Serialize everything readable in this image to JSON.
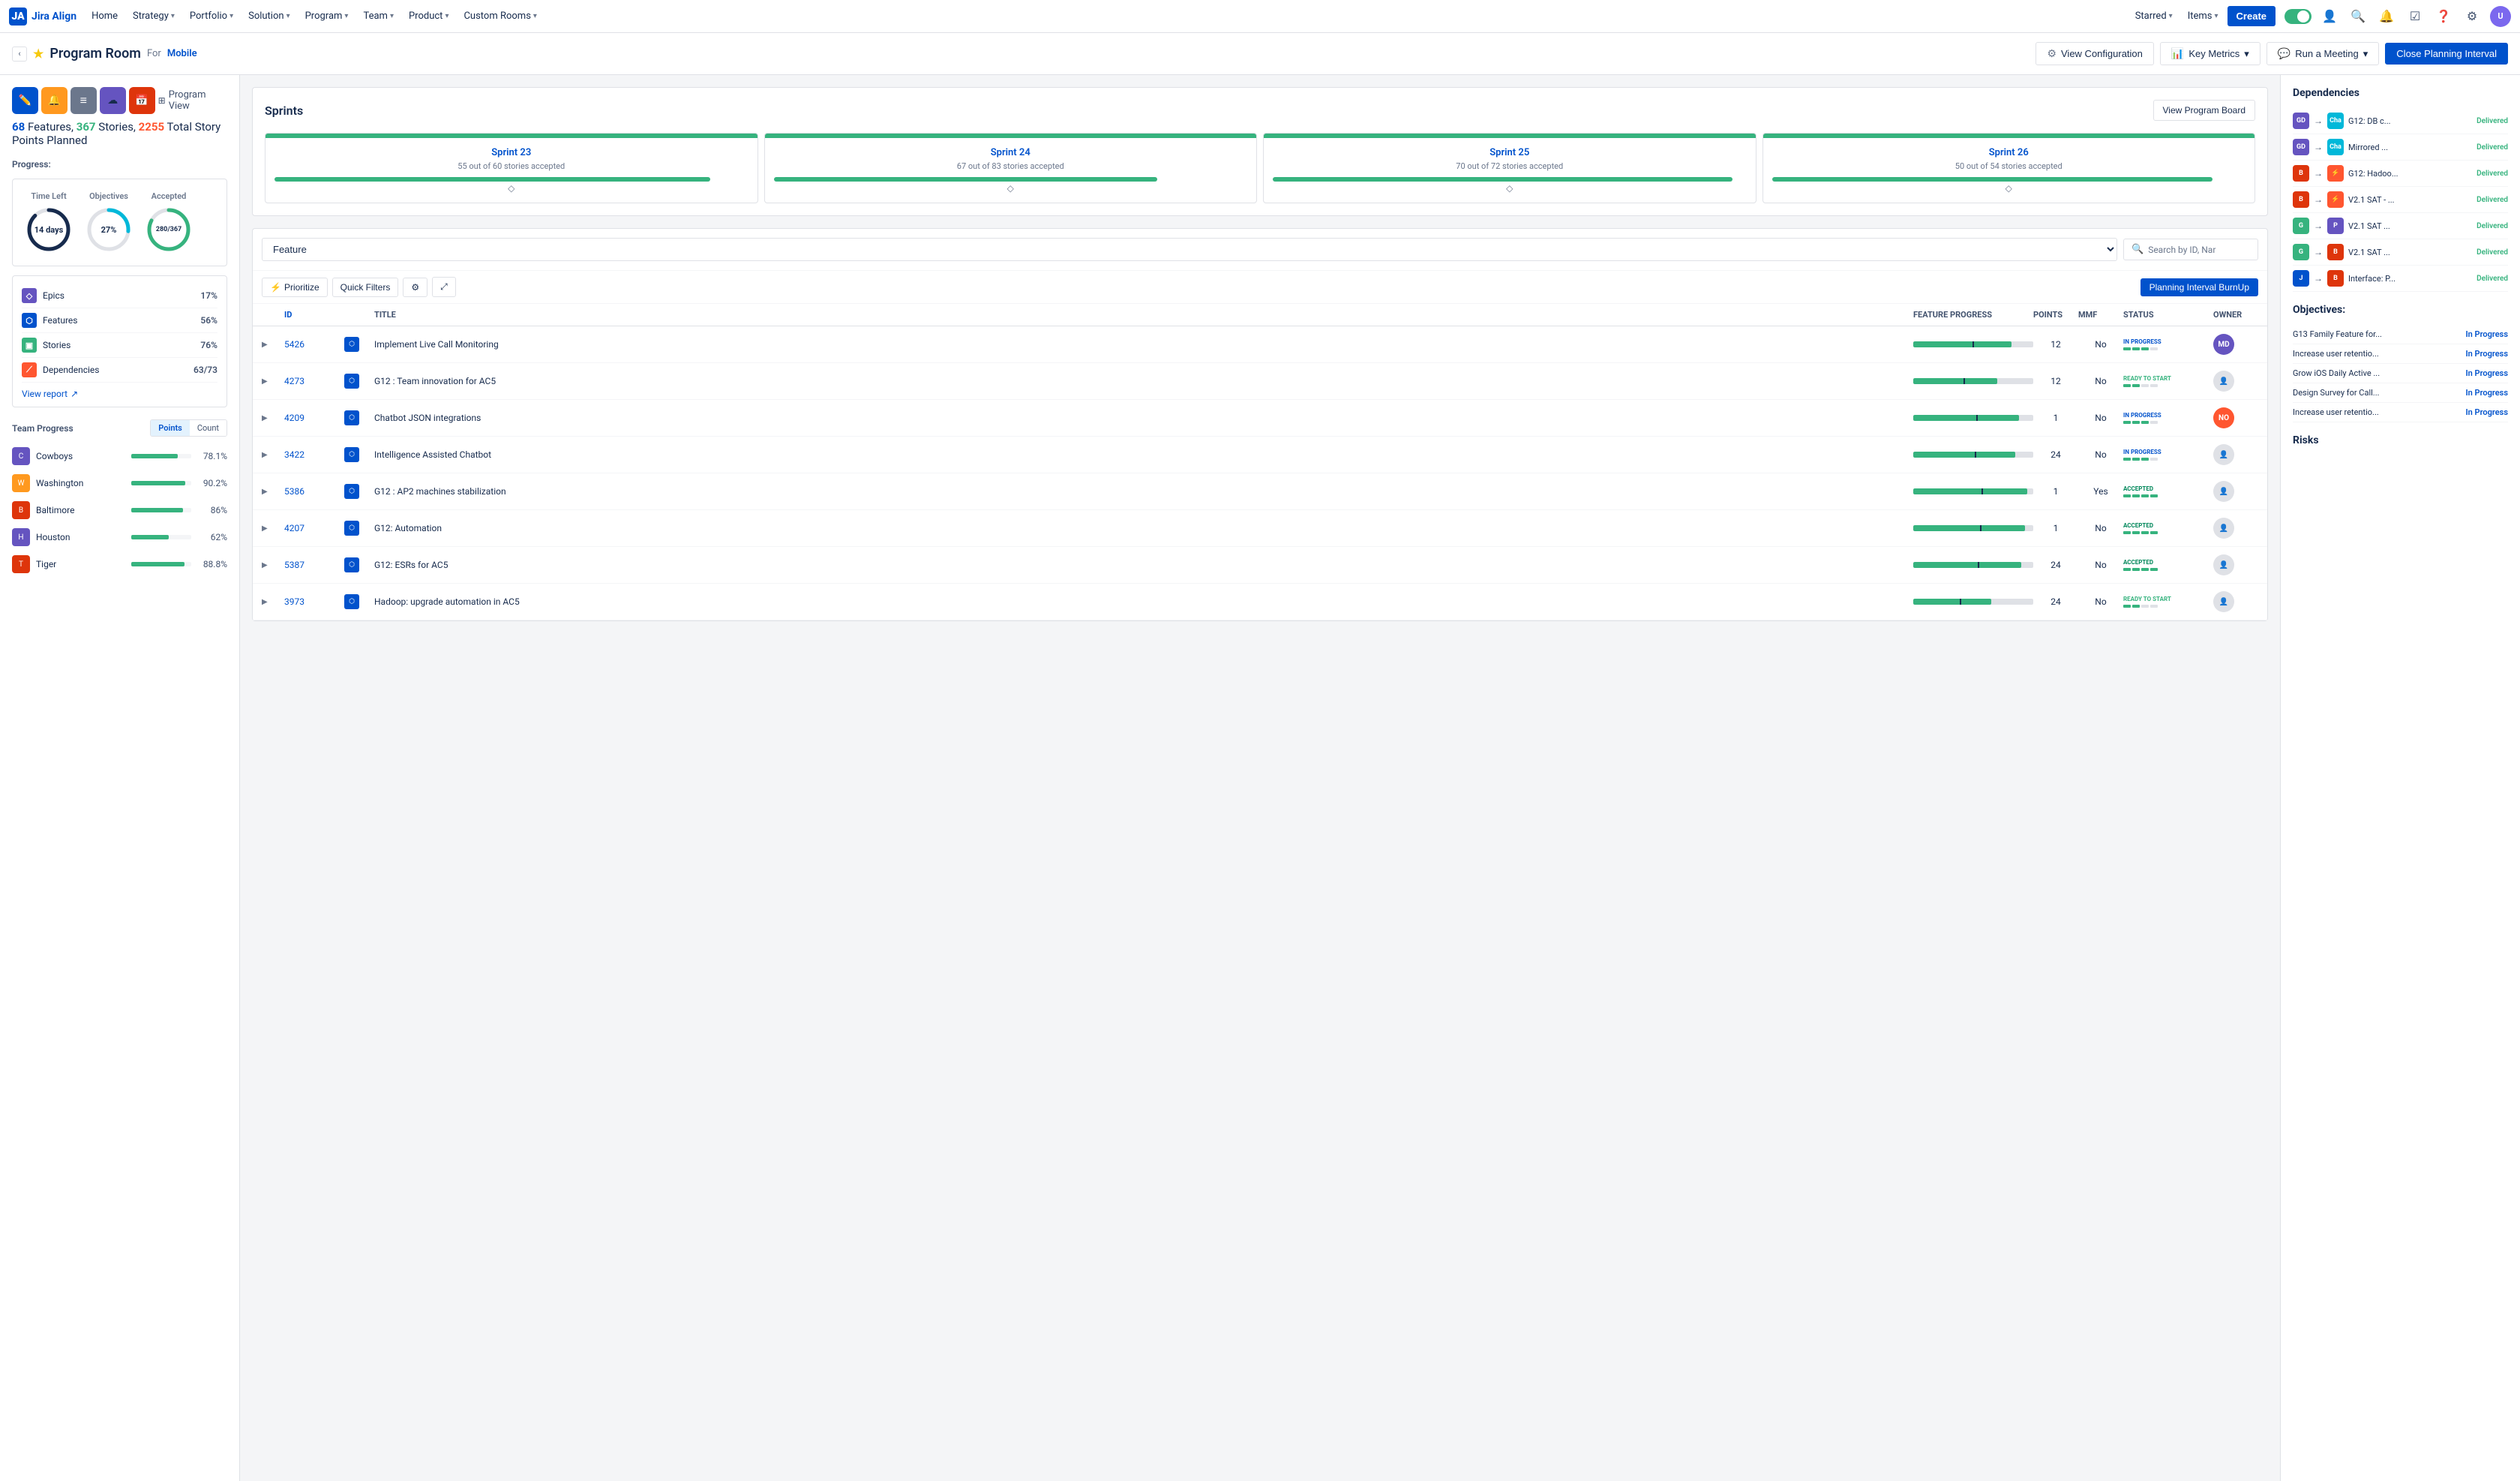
{
  "nav": {
    "logo_text": "Jira Align",
    "items": [
      {
        "label": "Home",
        "has_dropdown": false
      },
      {
        "label": "Strategy",
        "has_dropdown": true
      },
      {
        "label": "Portfolio",
        "has_dropdown": true
      },
      {
        "label": "Solution",
        "has_dropdown": true
      },
      {
        "label": "Program",
        "has_dropdown": true
      },
      {
        "label": "Team",
        "has_dropdown": true
      },
      {
        "label": "Product",
        "has_dropdown": true
      },
      {
        "label": "Custom Rooms",
        "has_dropdown": true
      }
    ],
    "starred_label": "Starred",
    "items_label": "Items",
    "create_label": "Create"
  },
  "sub_nav": {
    "title": "Program Room",
    "for_text": "For",
    "mobile_text": "Mobile",
    "view_config_label": "View Configuration",
    "key_metrics_label": "Key Metrics",
    "run_meeting_label": "Run a Meeting",
    "close_pi_label": "Close Planning Interval"
  },
  "summary": {
    "features_count": "68",
    "stories_count": "367",
    "points_count": "2255",
    "text": "Features,",
    "stories_text": "Stories,",
    "points_text": "Total Story Points Planned"
  },
  "progress": {
    "label": "Progress:",
    "time_left_label": "Time Left",
    "objectives_label": "Objectives",
    "accepted_label": "Accepted",
    "time_left_value": "14 days",
    "objectives_value": "27%",
    "accepted_value": "280/367",
    "metrics": [
      {
        "icon": "E",
        "label": "Epics",
        "value": "17%",
        "color": "#6554c0"
      },
      {
        "icon": "F",
        "label": "Features",
        "value": "56%",
        "color": "#0052cc"
      },
      {
        "icon": "S",
        "label": "Stories",
        "value": "76%",
        "color": "#36b37e"
      },
      {
        "icon": "D",
        "label": "Dependencies",
        "value": "63/73",
        "color": "#ff5630"
      }
    ],
    "view_report_label": "View report"
  },
  "team_progress": {
    "title": "Team Progress",
    "tab_points": "Points",
    "tab_count": "Count",
    "teams": [
      {
        "name": "Cowboys",
        "value": "78.1%",
        "pct": 78,
        "color": "#6554c0"
      },
      {
        "name": "Washington",
        "value": "90.2%",
        "pct": 90,
        "color": "#ff991f"
      },
      {
        "name": "Baltimore",
        "value": "86%",
        "pct": 86,
        "color": "#de350b"
      },
      {
        "name": "Houston",
        "value": "62%",
        "pct": 62,
        "color": "#6554c0"
      },
      {
        "name": "Tiger",
        "value": "88.8%",
        "pct": 89,
        "color": "#de350b"
      }
    ]
  },
  "sprints": {
    "title": "Sprints",
    "view_board_label": "View Program Board",
    "items": [
      {
        "name": "Sprint 23",
        "stats": "55 out of 60 stories accepted",
        "pct": 92
      },
      {
        "name": "Sprint 24",
        "stats": "67 out of 83 stories accepted",
        "pct": 81
      },
      {
        "name": "Sprint 25",
        "stats": "70 out of 72 stories accepted",
        "pct": 97
      },
      {
        "name": "Sprint 26",
        "stats": "50 out of 54 stories accepted",
        "pct": 93
      }
    ]
  },
  "features_table": {
    "filter_label": "Feature",
    "search_placeholder": "Search by ID, Nar",
    "prioritize_label": "Prioritize",
    "quick_filters_label": "Quick Filters",
    "burnup_label": "Planning Interval BurnUp",
    "columns": [
      "",
      "ID",
      "",
      "Title",
      "Feature Progress",
      "Points",
      "MMF",
      "Status",
      "Owner"
    ],
    "rows": [
      {
        "id": "5426",
        "title": "Implement Live Call Monitoring",
        "points": "12",
        "mmf": "No",
        "status": "IN PROGRESS",
        "status_type": "in_progress",
        "pct": 82,
        "avatar": "MD",
        "avatar_color": "#6554c0"
      },
      {
        "id": "4273",
        "title": "G12 : Team innovation for AC5",
        "points": "12",
        "mmf": "No",
        "status": "READY TO START",
        "status_type": "ready",
        "pct": 70,
        "avatar": "👤",
        "avatar_color": "#dfe1e6"
      },
      {
        "id": "4209",
        "title": "Chatbot JSON integrations",
        "points": "1",
        "mmf": "No",
        "status": "IN PROGRESS",
        "status_type": "in_progress",
        "pct": 88,
        "avatar": "NO",
        "avatar_color": "#ff5630"
      },
      {
        "id": "3422",
        "title": "Intelligence Assisted Chatbot",
        "points": "24",
        "mmf": "No",
        "status": "IN PROGRESS",
        "status_type": "in_progress",
        "pct": 85,
        "avatar": "👤",
        "avatar_color": "#dfe1e6"
      },
      {
        "id": "5386",
        "title": "G12 : AP2 machines stabilization",
        "points": "1",
        "mmf": "Yes",
        "status": "ACCEPTED",
        "status_type": "accepted",
        "pct": 95,
        "avatar": "👤",
        "avatar_color": "#dfe1e6"
      },
      {
        "id": "4207",
        "title": "G12: Automation",
        "points": "1",
        "mmf": "No",
        "status": "ACCEPTED",
        "status_type": "accepted",
        "pct": 93,
        "avatar": "👤",
        "avatar_color": "#dfe1e6"
      },
      {
        "id": "5387",
        "title": "G12: ESRs for AC5",
        "points": "24",
        "mmf": "No",
        "status": "ACCEPTED",
        "status_type": "accepted",
        "pct": 90,
        "avatar": "👤",
        "avatar_color": "#dfe1e6"
      },
      {
        "id": "3973",
        "title": "Hadoop: upgrade automation in AC5",
        "points": "24",
        "mmf": "No",
        "status": "READY TO START",
        "status_type": "ready",
        "pct": 65,
        "avatar": "👤",
        "avatar_color": "#dfe1e6"
      }
    ]
  },
  "dependencies": {
    "title": "Dependencies",
    "items": [
      {
        "from_color": "#6554c0",
        "from": "GD",
        "to_color": "#00b8d9",
        "to": "Cha",
        "label": "G12: DB c...",
        "status": "Delivered"
      },
      {
        "from_color": "#6554c0",
        "from": "GD",
        "to_color": "#00b8d9",
        "to": "Cha",
        "label": "Mirrored ...",
        "status": "Delivered"
      },
      {
        "from_color": "#de350b",
        "from": "B",
        "to_color": "#ff5630",
        "to": "⚡",
        "label": "G12: Hadoo...",
        "status": "Delivered"
      },
      {
        "from_color": "#de350b",
        "from": "B",
        "to_color": "#ff5630",
        "to": "⚡",
        "label": "V2.1 SAT - ...",
        "status": "Delivered"
      },
      {
        "from_color": "#36b37e",
        "from": "G",
        "to_color": "#6554c0",
        "to": "P",
        "label": "V2.1 SAT ...",
        "status": "Delivered"
      },
      {
        "from_color": "#36b37e",
        "from": "G",
        "to_color": "#de350b",
        "to": "B",
        "label": "V2.1 SAT ...",
        "status": "Delivered"
      },
      {
        "from_color": "#0052cc",
        "from": "J",
        "to_color": "#de350b",
        "to": "B",
        "label": "Interface: P...",
        "status": "Delivered"
      }
    ]
  },
  "objectives": {
    "title": "Objectives:",
    "items": [
      {
        "label": "G13 Family Feature for...",
        "status": "In Progress"
      },
      {
        "label": "Increase user retentio...",
        "status": "In Progress"
      },
      {
        "label": "Grow iOS Daily Active ...",
        "status": "In Progress"
      },
      {
        "label": "Design Survey for Call...",
        "status": "In Progress"
      },
      {
        "label": "Increase user retentio...",
        "status": "In Progress"
      }
    ]
  },
  "risks": {
    "title": "Risks"
  },
  "view_icons": [
    {
      "icon": "✏️",
      "color": "#0052cc",
      "label": "edit-icon"
    },
    {
      "icon": "🔔",
      "color": "#ff991f",
      "label": "bell-icon"
    },
    {
      "icon": "≡",
      "color": "#6b778c",
      "label": "list-icon"
    },
    {
      "icon": "☁",
      "color": "#6554c0",
      "label": "cloud-icon"
    },
    {
      "icon": "📅",
      "color": "#de350b",
      "label": "calendar-icon"
    }
  ],
  "program_view_label": "Program View"
}
